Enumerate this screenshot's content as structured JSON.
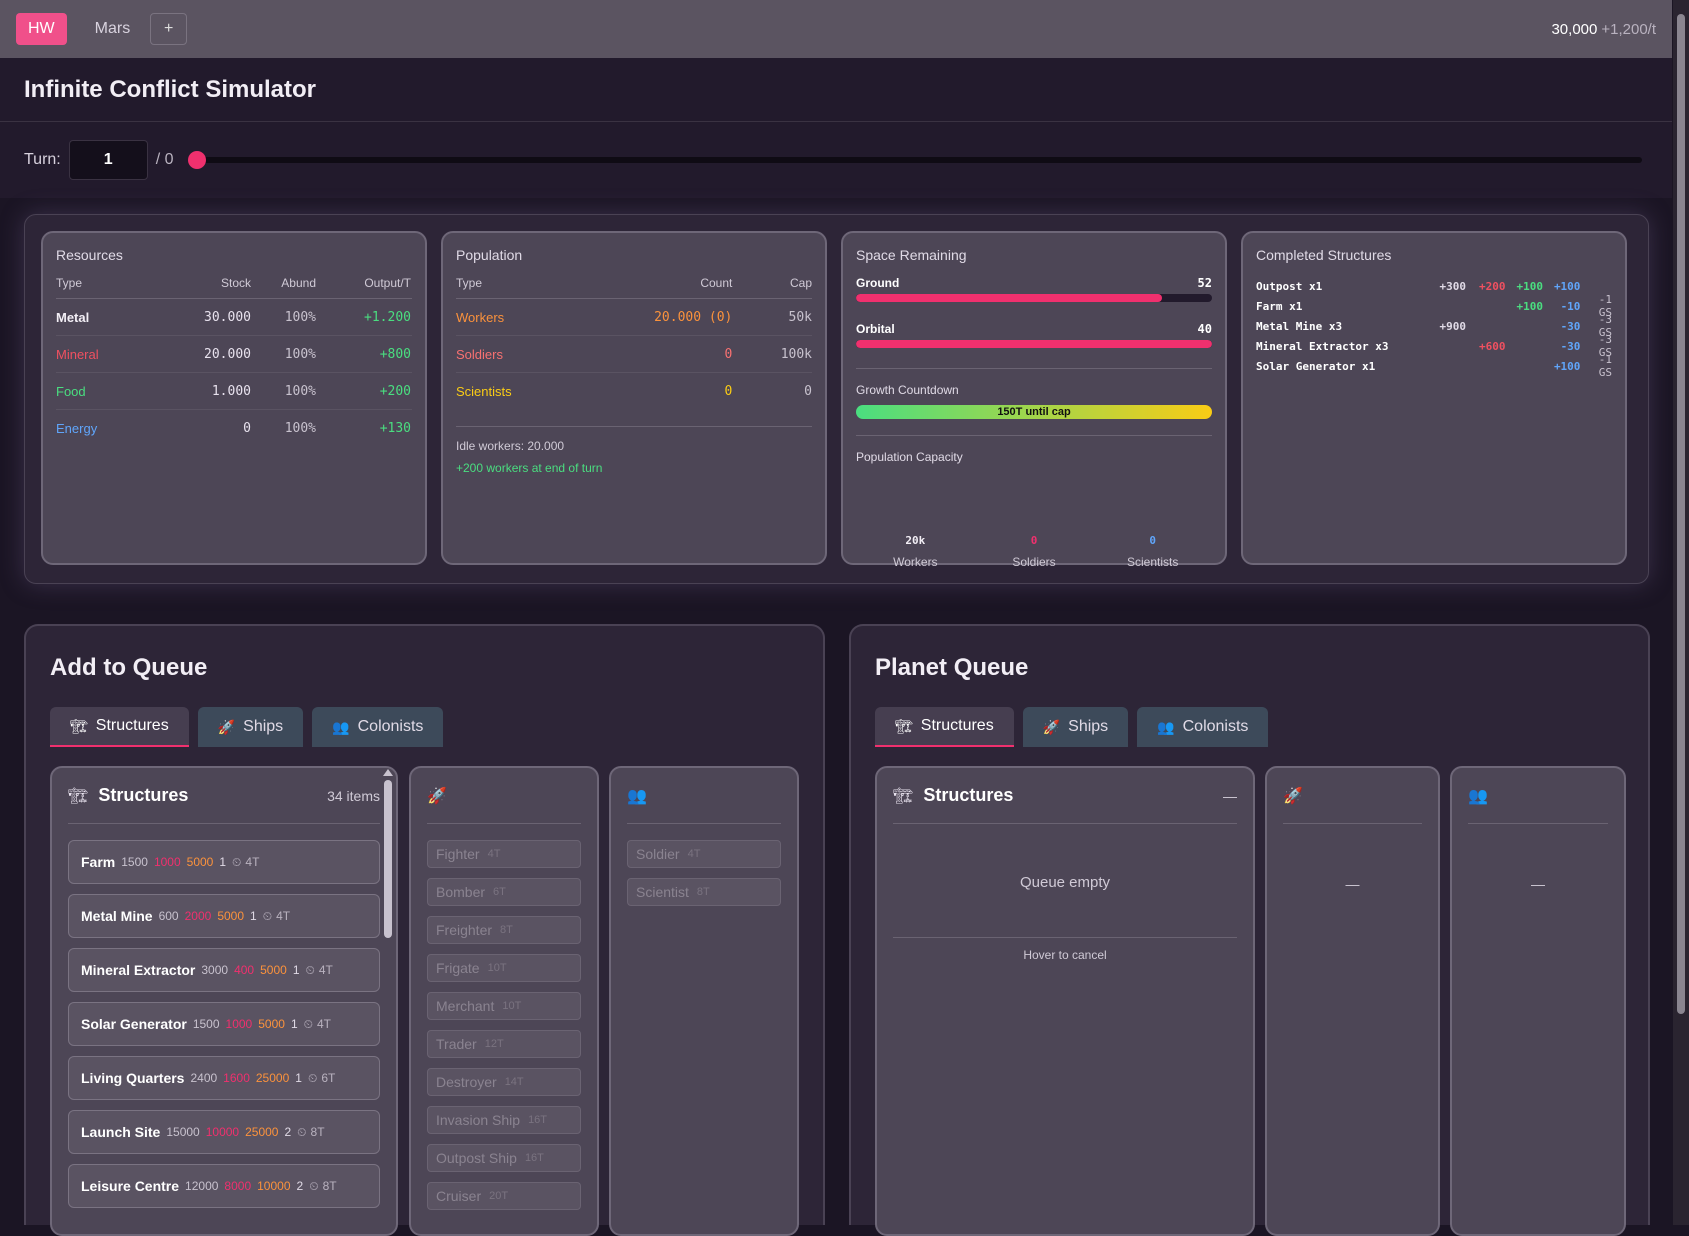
{
  "topbar": {
    "tabs": [
      "HW",
      "Mars"
    ],
    "add_label": "+",
    "resource": "30,000",
    "income": "+1,200/t"
  },
  "app_title": "Infinite Conflict Simulator",
  "turn": {
    "label": "Turn:",
    "value": "1",
    "max": "/ 0"
  },
  "resources": {
    "title": "Resources",
    "headers": [
      "Type",
      "Stock",
      "Abund",
      "Output/T"
    ],
    "rows": [
      {
        "type": "Metal",
        "stock": "30.000",
        "abund": "100%",
        "output": "+1.200",
        "color": "#f2eef5"
      },
      {
        "type": "Mineral",
        "stock": "20.000",
        "abund": "100%",
        "output": "+800",
        "color": "#f05060"
      },
      {
        "type": "Food",
        "stock": "1.000",
        "abund": "100%",
        "output": "+200",
        "color": "#4ade80"
      },
      {
        "type": "Energy",
        "stock": "0",
        "abund": "100%",
        "output": "+130",
        "color": "#60a5fa"
      }
    ]
  },
  "population": {
    "title": "Population",
    "headers": [
      "Type",
      "Count",
      "Cap"
    ],
    "rows": [
      {
        "type": "Workers",
        "count": "20.000 (0)",
        "cap": "50k",
        "color": "#fb923c"
      },
      {
        "type": "Soldiers",
        "count": "0",
        "cap": "100k",
        "color": "#f87171"
      },
      {
        "type": "Scientists",
        "count": "0",
        "cap": "0",
        "color": "#facc15"
      }
    ],
    "idle": "Idle workers: 20.000",
    "growth_note": "+200 workers at end of turn"
  },
  "space": {
    "title": "Space Remaining",
    "ground_label": "Ground",
    "ground_value": "52",
    "ground_fill": 0.86,
    "orbital_label": "Orbital",
    "orbital_value": "40",
    "orbital_fill": 1.0,
    "growth_label": "Growth Countdown",
    "growth_text": "150T until cap",
    "capacity_label": "Population Capacity",
    "capacity": [
      {
        "value": "20k",
        "label": "Workers",
        "color": "#f2eef5"
      },
      {
        "value": "0",
        "label": "Soldiers",
        "color": "#f0306e"
      },
      {
        "value": "0",
        "label": "Scientists",
        "color": "#60a5fa"
      }
    ]
  },
  "completed": {
    "title": "Completed Structures",
    "rows": [
      {
        "name": "Outpost x1",
        "a": "+300",
        "b": "+200",
        "c": "+100",
        "d": "+100",
        "e": ""
      },
      {
        "name": "Farm x1",
        "a": "",
        "b": "",
        "c": "+100",
        "d": "-10",
        "e": "-1 GS"
      },
      {
        "name": "Metal Mine x3",
        "a": "+900",
        "b": "",
        "c": "",
        "d": "-30",
        "e": "-3 GS"
      },
      {
        "name": "Mineral Extractor x3",
        "a": "",
        "b": "+600",
        "c": "",
        "d": "-30",
        "e": "-3 GS"
      },
      {
        "name": "Solar Generator x1",
        "a": "",
        "b": "",
        "c": "",
        "d": "+100",
        "e": "-1 GS"
      }
    ]
  },
  "add_queue": {
    "title": "Add to Queue",
    "tabs": [
      "Structures",
      "Ships",
      "Colonists"
    ],
    "structures_title": "Structures",
    "count": "34 items",
    "structures": [
      {
        "name": "Farm",
        "metal": "1500",
        "mineral": "1000",
        "food": "5000",
        "workers": "1",
        "time": "4T"
      },
      {
        "name": "Metal Mine",
        "metal": "600",
        "mineral": "2000",
        "food": "5000",
        "workers": "1",
        "time": "4T"
      },
      {
        "name": "Mineral Extractor",
        "metal": "3000",
        "mineral": "400",
        "food": "5000",
        "workers": "1",
        "time": "4T"
      },
      {
        "name": "Solar Generator",
        "metal": "1500",
        "mineral": "1000",
        "food": "5000",
        "workers": "1",
        "time": "4T"
      },
      {
        "name": "Living Quarters",
        "metal": "2400",
        "mineral": "1600",
        "food": "25000",
        "workers": "1",
        "time": "6T"
      },
      {
        "name": "Launch Site",
        "metal": "15000",
        "mineral": "10000",
        "food": "25000",
        "workers": "2",
        "time": "8T"
      },
      {
        "name": "Leisure Centre",
        "metal": "12000",
        "mineral": "8000",
        "food": "10000",
        "workers": "2",
        "time": "8T"
      }
    ],
    "ships": [
      {
        "name": "Fighter",
        "time": "4T"
      },
      {
        "name": "Bomber",
        "time": "6T"
      },
      {
        "name": "Freighter",
        "time": "8T"
      },
      {
        "name": "Frigate",
        "time": "10T"
      },
      {
        "name": "Merchant",
        "time": "10T"
      },
      {
        "name": "Trader",
        "time": "12T"
      },
      {
        "name": "Destroyer",
        "time": "14T"
      },
      {
        "name": "Invasion Ship",
        "time": "16T"
      },
      {
        "name": "Outpost Ship",
        "time": "16T"
      },
      {
        "name": "Cruiser",
        "time": "20T"
      }
    ],
    "colonists": [
      {
        "name": "Soldier",
        "time": "4T"
      },
      {
        "name": "Scientist",
        "time": "8T"
      }
    ]
  },
  "planet_queue": {
    "title": "Planet Queue",
    "tabs": [
      "Structures",
      "Ships",
      "Colonists"
    ],
    "structures_title": "Structures",
    "count": "—",
    "empty": "Queue empty",
    "hint": "Hover to cancel",
    "ships_empty": "—",
    "colonists_empty": "—"
  },
  "icons": {
    "structures": "crane-icon",
    "ships": "rocket-icon",
    "colonists": "people-icon",
    "time": "clock-icon"
  }
}
